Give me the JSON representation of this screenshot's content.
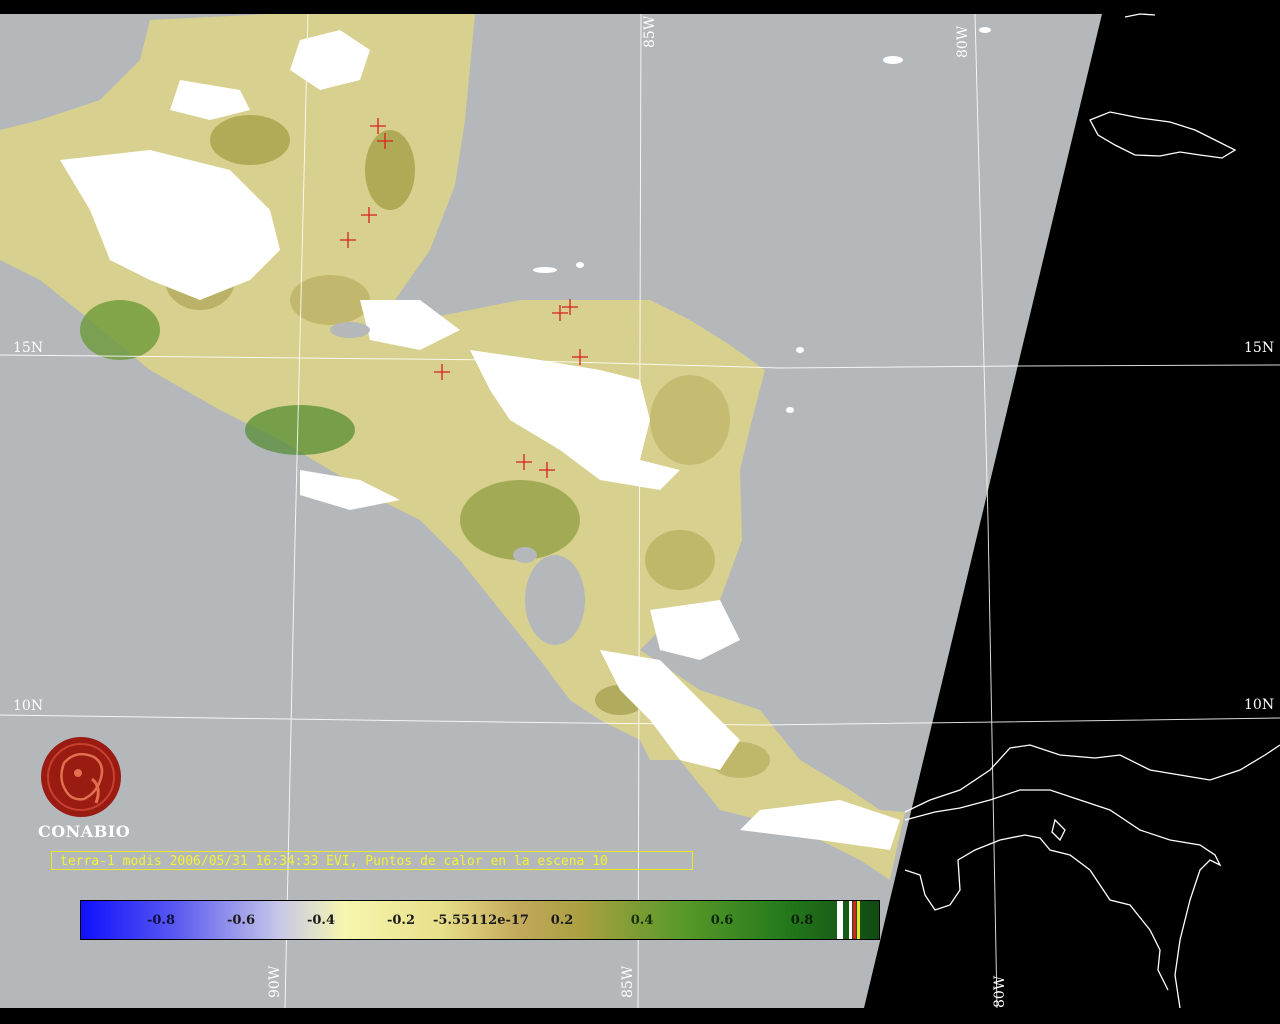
{
  "map": {
    "graticule_labels": {
      "lon_85w_top": "85W",
      "lon_80w_top": "80W",
      "lat_15n_left": "15N",
      "lat_15n_right": "15N",
      "lat_10n_left": "10N",
      "lat_10n_right": "10N",
      "lon_90w_bottom": "90W",
      "lon_85w_bottom": "85W",
      "lon_80w_bottom": "80W"
    },
    "caption": "terra-1 modis 2006/05/31 16:34:33 EVI, Puntos de calor en la escena 10",
    "logo_text": "CONABIO",
    "legend": {
      "tick_labels": [
        "-0.8",
        "-0.6",
        "-0.4",
        "-0.2",
        "-5.55112e-17",
        "0.2",
        "0.4",
        "0.6",
        "0.8"
      ]
    },
    "colors": {
      "swath_fill": "#b4b8ba",
      "no_data": "#000000",
      "cloud": "#ffffff",
      "hotspot_marker": "#d82020",
      "caption_text": "#f2f233",
      "coastline_outside_swath": "#ffffff",
      "logo": "#9a1b12"
    },
    "hotspot_marker_count": 12
  }
}
